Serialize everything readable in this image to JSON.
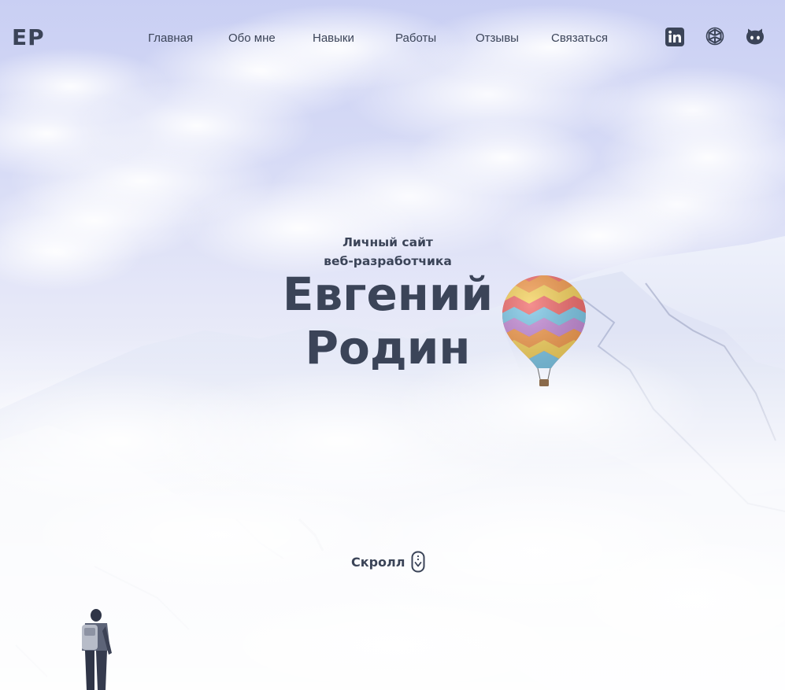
{
  "header": {
    "logo": "ЕР",
    "nav": [
      {
        "label": "Главная"
      },
      {
        "label": "Обо мне"
      },
      {
        "label": "Навыки"
      },
      {
        "label": "Работы"
      },
      {
        "label": "Отзывы"
      },
      {
        "label": "Связаться"
      }
    ],
    "social": [
      {
        "icon": "linkedin-icon"
      },
      {
        "icon": "openai-icon"
      },
      {
        "icon": "github-icon"
      }
    ]
  },
  "hero": {
    "subtitle_line1": "Личный сайт",
    "subtitle_line2": "веб-разработчика",
    "name_first": "Евгений",
    "name_last": "Родин",
    "scroll_label": "Скролл"
  },
  "colors": {
    "text": "#3b4458",
    "sky": "#c9cff3",
    "snow": "#f4f5fb"
  }
}
